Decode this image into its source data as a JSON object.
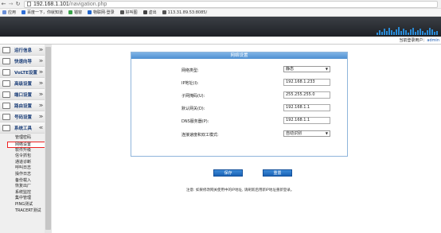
{
  "browser": {
    "url_host": "192.168.1.101",
    "url_path": "/navigation.php",
    "bookmarks": [
      {
        "label": "应用",
        "color": "#6a8fd8"
      },
      {
        "label": "百度一下，你就知道",
        "color": "#2f6fd8"
      },
      {
        "label": "锚窗",
        "color": "#3aa24a"
      },
      {
        "label": "物联网·登录",
        "color": "#2266cc"
      },
      {
        "label": "好叫图",
        "color": "#555555"
      },
      {
        "label": "虚出",
        "color": "#444444"
      },
      {
        "label": "113.31.89.53:8085/",
        "color": "#555555"
      }
    ]
  },
  "userbar": {
    "prefix": "当前登录用户：",
    "username": "admin"
  },
  "sidebar": {
    "menus": [
      {
        "label": "运行信息",
        "arrow": "≫"
      },
      {
        "label": "快速向导",
        "arrow": "≫"
      },
      {
        "label": "VoLTE设置",
        "arrow": "≫"
      },
      {
        "label": "高级设置",
        "arrow": "≫"
      },
      {
        "label": "端口设置",
        "arrow": "≫"
      },
      {
        "label": "路由设置",
        "arrow": "≫"
      },
      {
        "label": "号码设置",
        "arrow": "≫"
      },
      {
        "label": "系统工具",
        "arrow": "≪"
      }
    ],
    "submenu": [
      "管理密码",
      "网络设置",
      "软件升级",
      "信令抓包",
      "通道诊断",
      "呼叫日志",
      "操作日志",
      "备份载入",
      "恢复出厂",
      "系统监控",
      "集中管理",
      "PING测试",
      "TRACERT测试"
    ],
    "active_submenu": "网络设置"
  },
  "panel": {
    "title": "网络设置",
    "fields": [
      {
        "label": "网络类型:",
        "type": "select",
        "value": "静态"
      },
      {
        "label": "IP地址(I):",
        "type": "input",
        "value": "192.168.1.233"
      },
      {
        "label": "子网掩码(U):",
        "type": "input",
        "value": "255.255.255.0"
      },
      {
        "label": "默认网关(D):",
        "type": "input",
        "value": "192.168.1.1"
      },
      {
        "label": "DNS服务器(P):",
        "type": "input",
        "value": "192.168.1.1"
      },
      {
        "label": "连接速度和双工模式:",
        "type": "select",
        "value": "自动识别"
      }
    ]
  },
  "buttons": {
    "save": "保存",
    "reset": "重置"
  },
  "note": "注意: 如果修改网关使用中的IP地址, 请刷新后用新IP地址重新登录。"
}
